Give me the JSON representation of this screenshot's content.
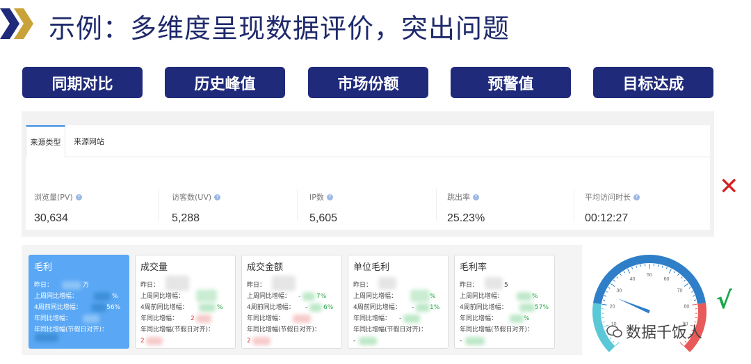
{
  "title": "示例：多维度呈现数据评价，突出问题",
  "pills": [
    "同期对比",
    "历史峰值",
    "市场份额",
    "预警值",
    "目标达成"
  ],
  "tabs": [
    {
      "label": "来源类型",
      "active": true
    },
    {
      "label": "来源网站",
      "active": false
    }
  ],
  "metrics": [
    {
      "label": "浏览量(PV)",
      "value": "30,634"
    },
    {
      "label": "访客数(UV)",
      "value": "5,288"
    },
    {
      "label": "IP数",
      "value": "5,605"
    },
    {
      "label": "跳出率",
      "value": "25.23%"
    },
    {
      "label": "平均访问时长",
      "value": "00:12:27"
    }
  ],
  "cards": [
    {
      "title": "毛利",
      "active": true,
      "rows": [
        "昨日：",
        "上周同比增幅：",
        "4周前同比增幅：",
        "年同比增幅：",
        "年同比增幅(节假日对齐)："
      ],
      "fragments": [
        "万",
        "%",
        "56%"
      ]
    },
    {
      "title": "成交量",
      "active": false,
      "rows": [
        "昨日：",
        "上周同比增幅：",
        "4周前同比增幅：",
        "年同比增幅：",
        "年同比增幅(节假日对齐)："
      ],
      "fragments": [
        "",
        "",
        "%",
        "2",
        "2"
      ]
    },
    {
      "title": "成交金额",
      "active": false,
      "rows": [
        "昨日：",
        "上周同比增幅：",
        "4周前同比增幅：",
        "年同比增幅：",
        "年同比增幅(节假日对齐)："
      ],
      "fragments": [
        "-",
        "7%",
        "-",
        "6%",
        "2"
      ]
    },
    {
      "title": "单位毛利",
      "active": false,
      "rows": [
        "昨日：",
        "上周同比增幅：",
        "4周前同比增幅：",
        "年同比增幅：",
        "年同比增幅(节假日对齐)："
      ],
      "fragments": [
        "-",
        "%",
        "-",
        "1%",
        "-"
      ]
    },
    {
      "title": "毛利率",
      "active": false,
      "rows": [
        "昨日：",
        "上周同比增幅：",
        "4周前同比增幅：",
        "年同比增幅：",
        "年同比增幅(节假日对齐)："
      ],
      "fragments": [
        "5",
        "%",
        "57%",
        "%",
        "-"
      ]
    }
  ],
  "gauge": {
    "ticks": [
      "10",
      "20",
      "30",
      "40",
      "50",
      "60",
      "70",
      "80",
      "90"
    ],
    "value_fraction": 0.25,
    "colors": {
      "low": "#5bc8d8",
      "mid": "#2f7fc8",
      "high": "#e85a5a"
    }
  },
  "marks": {
    "cross": "✕",
    "check": "√"
  },
  "watermark": "数据千饭人",
  "colors": {
    "accent": "#1f2a7a",
    "active_card": "#5aa8f5",
    "title": "#1f2a6b"
  }
}
